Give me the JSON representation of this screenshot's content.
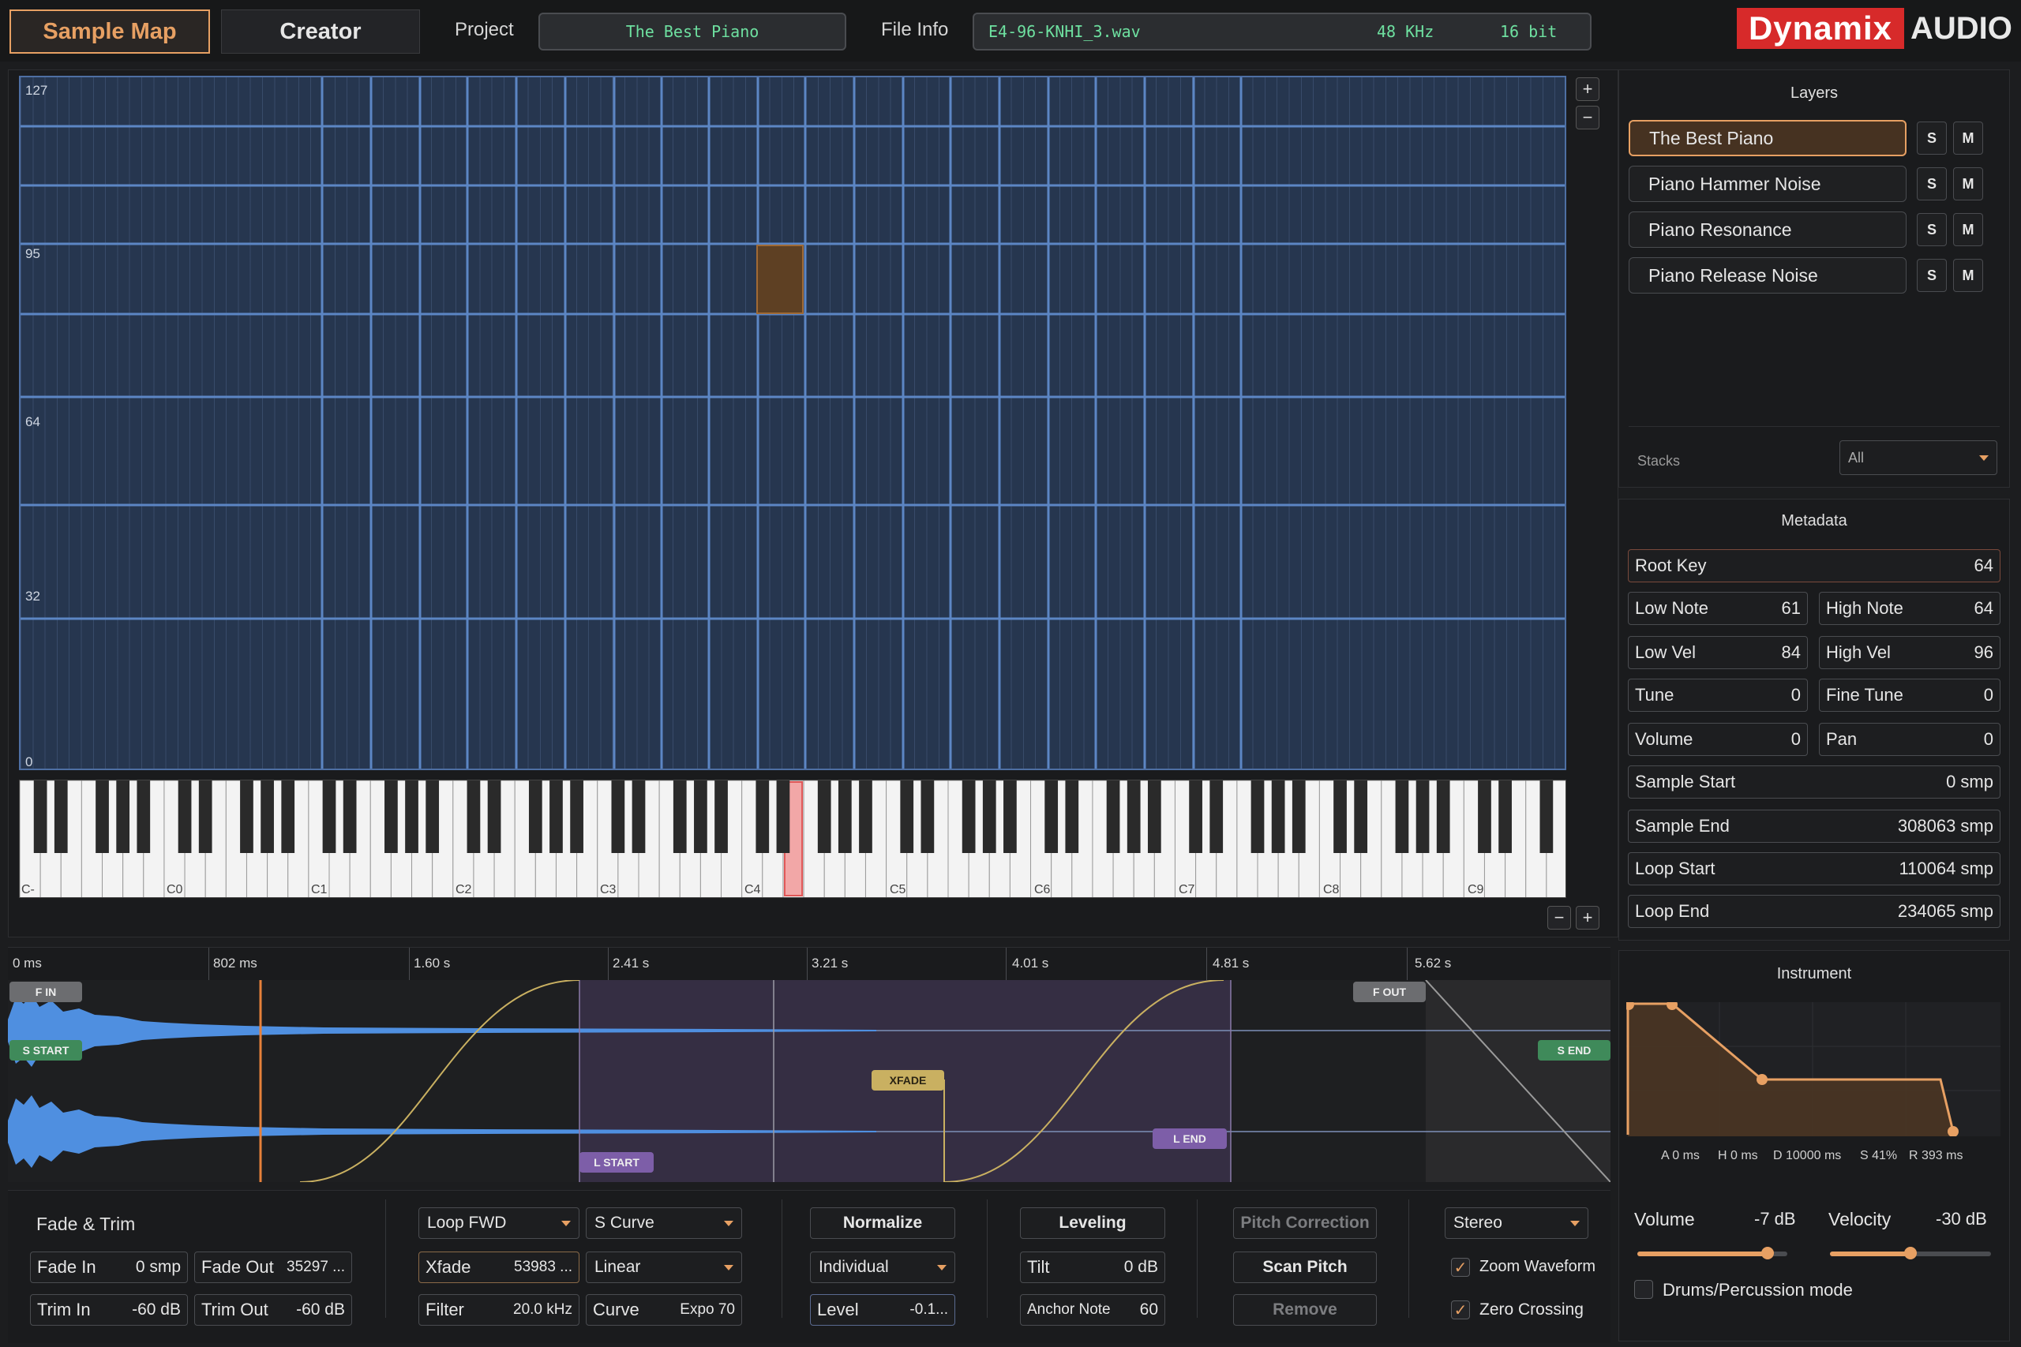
{
  "topbar": {
    "tab_sample_map": "Sample Map",
    "tab_creator": "Creator",
    "project_label": "Project",
    "project_name": "The Best Piano",
    "fileinfo_label": "File Info",
    "file_name": "E4-96-KNHI_3.wav",
    "sample_rate": "48 KHz",
    "bit_depth": "16 bit",
    "logo_main": "Dynamix",
    "logo_sub": "AUDIO"
  },
  "map": {
    "velocity_labels": [
      "127",
      "95",
      "64",
      "32",
      "0"
    ],
    "zone": {
      "low_note": 61,
      "high_note": 64,
      "low_vel": 84,
      "high_vel": 96
    },
    "zoom_plus": "+",
    "zoom_minus": "−",
    "keyboard_octaves": [
      "C-",
      "C0",
      "C1",
      "C2",
      "C3",
      "C4",
      "C5",
      "C6",
      "C7",
      "C8",
      "C9"
    ],
    "highlighted_key": "E4"
  },
  "waveform": {
    "ruler": [
      "0 ms",
      "802 ms",
      "1.60 s",
      "2.41 s",
      "3.21 s",
      "4.01 s",
      "4.81 s",
      "5.62 s"
    ],
    "markers": {
      "fade_in": "F IN",
      "fade_out": "F OUT",
      "sample_start": "S START",
      "sample_end": "S END",
      "loop_start": "L START",
      "loop_end": "L END",
      "xfade": "XFADE"
    }
  },
  "controls": {
    "fade_trim_title": "Fade & Trim",
    "fade_in_label": "Fade In",
    "fade_in_value": "0 smp",
    "fade_out_label": "Fade Out",
    "fade_out_value": "35297 ...",
    "trim_in_label": "Trim In",
    "trim_in_value": "-60 dB",
    "trim_out_label": "Trim Out",
    "trim_out_value": "-60 dB",
    "loop_mode": "Loop FWD",
    "curve_type": "S Curve",
    "xfade_label": "Xfade",
    "xfade_value": "53983 ...",
    "xfade_curve": "Linear",
    "filter_label": "Filter",
    "filter_value": "20.0 kHz",
    "curve_label": "Curve",
    "curve_value": "Expo 70",
    "normalize": "Normalize",
    "normalize_mode": "Individual",
    "level_label": "Level",
    "level_value": "-0.1...",
    "leveling": "Leveling",
    "tilt_label": "Tilt",
    "tilt_value": "0 dB",
    "anchor_label": "Anchor Note",
    "anchor_value": "60",
    "pitch_correction": "Pitch Correction",
    "scan_pitch": "Scan Pitch",
    "remove": "Remove",
    "channel_mode": "Stereo",
    "zoom_waveform": "Zoom Waveform",
    "zero_crossing": "Zero Crossing"
  },
  "layers": {
    "title": "Layers",
    "items": [
      {
        "name": "The Best Piano",
        "selected": true
      },
      {
        "name": "Piano Hammer Noise",
        "selected": false
      },
      {
        "name": "Piano Resonance",
        "selected": false
      },
      {
        "name": "Piano Release Noise",
        "selected": false
      }
    ],
    "solo": "S",
    "mute": "M",
    "stacks_label": "Stacks",
    "stacks_value": "All"
  },
  "metadata": {
    "title": "Metadata",
    "root_key_label": "Root Key",
    "root_key": "64",
    "low_note_label": "Low Note",
    "low_note": "61",
    "high_note_label": "High Note",
    "high_note": "64",
    "low_vel_label": "Low Vel",
    "low_vel": "84",
    "high_vel_label": "High Vel",
    "high_vel": "96",
    "tune_label": "Tune",
    "tune": "0",
    "fine_tune_label": "Fine Tune",
    "fine_tune": "0",
    "volume_label": "Volume",
    "volume": "0",
    "pan_label": "Pan",
    "pan": "0",
    "sample_start_label": "Sample Start",
    "sample_start": "0 smp",
    "sample_end_label": "Sample End",
    "sample_end": "308063 smp",
    "loop_start_label": "Loop Start",
    "loop_start": "110064 smp",
    "loop_end_label": "Loop End",
    "loop_end": "234065 smp"
  },
  "instrument": {
    "title": "Instrument",
    "adsr_labels": [
      "A 0 ms",
      "H 0 ms",
      "D 10000 ms",
      "S 41%",
      "R 393 ms"
    ],
    "volume_label": "Volume",
    "volume_value": "-7 dB",
    "volume_level": 0.87,
    "velocity_label": "Velocity",
    "velocity_value": "-30 dB",
    "velocity_level": 0.5,
    "drums_mode": "Drums/Percussion mode"
  },
  "colors": {
    "accent": "#e7a063",
    "grid": "#26364f",
    "lcd_text": "#6ee0a0",
    "brand_red": "#d72a2a"
  }
}
